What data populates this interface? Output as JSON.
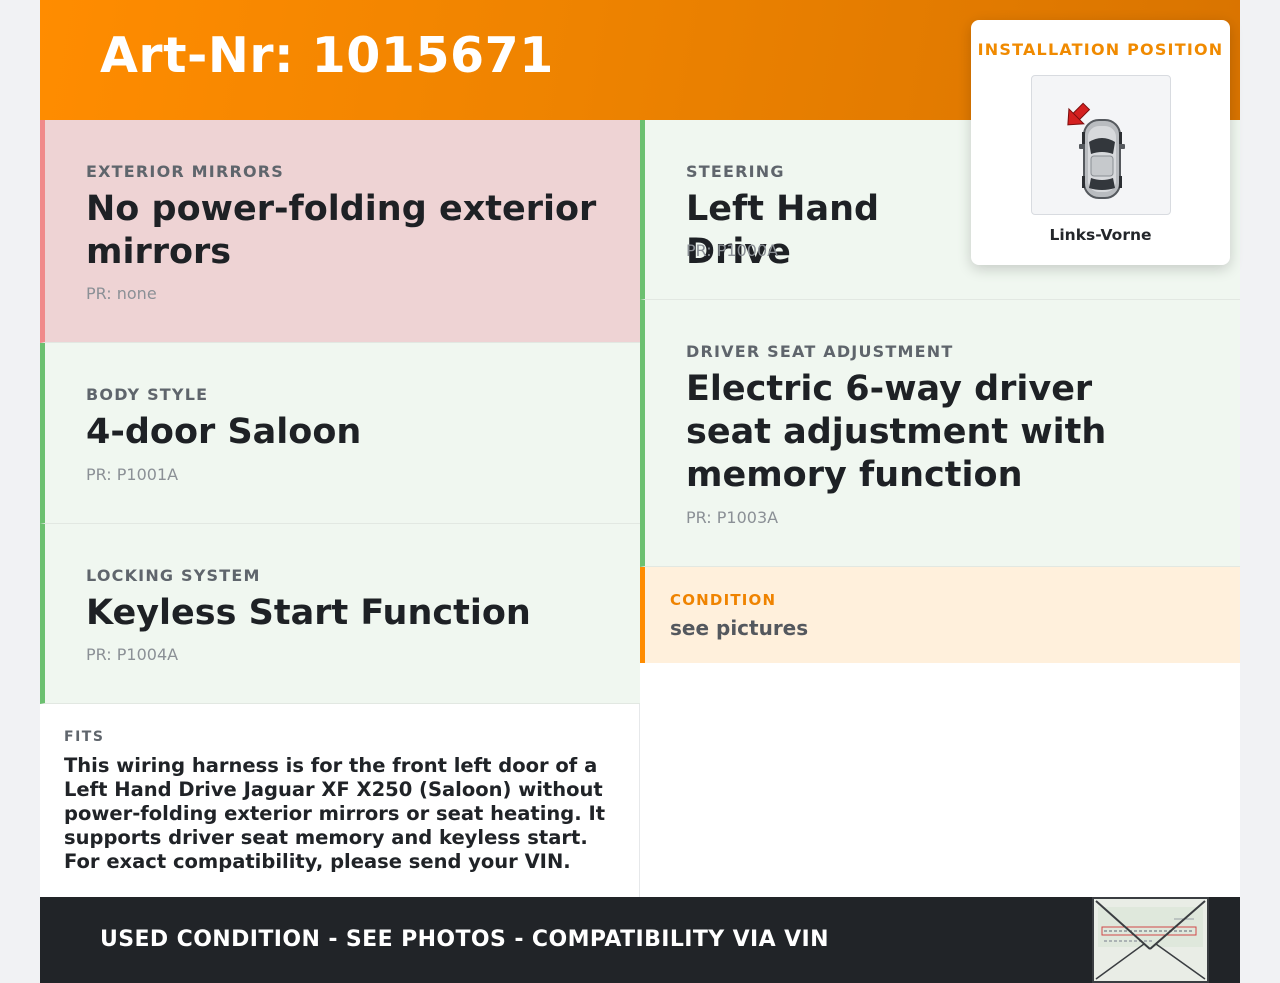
{
  "header": {
    "title": "Art-Nr: 1015671"
  },
  "cards": {
    "exterior_mirrors": {
      "label": "EXTERIOR MIRRORS",
      "value": "No power-folding exterior mirrors",
      "pr": "PR: none",
      "status": "negative"
    },
    "body_style": {
      "label": "BODY STYLE",
      "value": "4-door Saloon",
      "pr": "PR: P1001A",
      "status": "positive"
    },
    "locking_system": {
      "label": "LOCKING SYSTEM",
      "value": "Keyless Start Function",
      "pr": "PR: P1004A",
      "status": "positive"
    },
    "steering": {
      "label": "STEERING",
      "value": "Left Hand Drive",
      "pr": "PR: P1000A",
      "status": "positive"
    },
    "driver_seat": {
      "label": "DRIVER SEAT ADJUSTMENT",
      "value": "Electric 6-way driver seat adjustment with memory function",
      "pr": "PR: P1003A",
      "status": "positive"
    }
  },
  "condition": {
    "label": "CONDITION",
    "text": "see pictures"
  },
  "fits": {
    "label": "FITS",
    "text": "This wiring harness is for the front left door of a Left Hand Drive Jaguar XF X250 (Saloon) without power-folding exterior mirrors or seat heating. It supports driver seat memory and keyless start. For exact compatibility, please send your VIN."
  },
  "installation": {
    "title": "INSTALLATION POSITION",
    "caption": "Links-Vorne",
    "icon": "car-top-view-front-left-arrow"
  },
  "footer": {
    "text": "USED CONDITION - SEE PHOTOS - COMPATIBILITY VIA VIN",
    "thumbnail_icon": "vehicle-document-thumbnail"
  },
  "colors": {
    "accent": "#ff8c00",
    "positive": "#6cc070",
    "negative": "#f08a8a",
    "footer_bg": "#212428"
  }
}
